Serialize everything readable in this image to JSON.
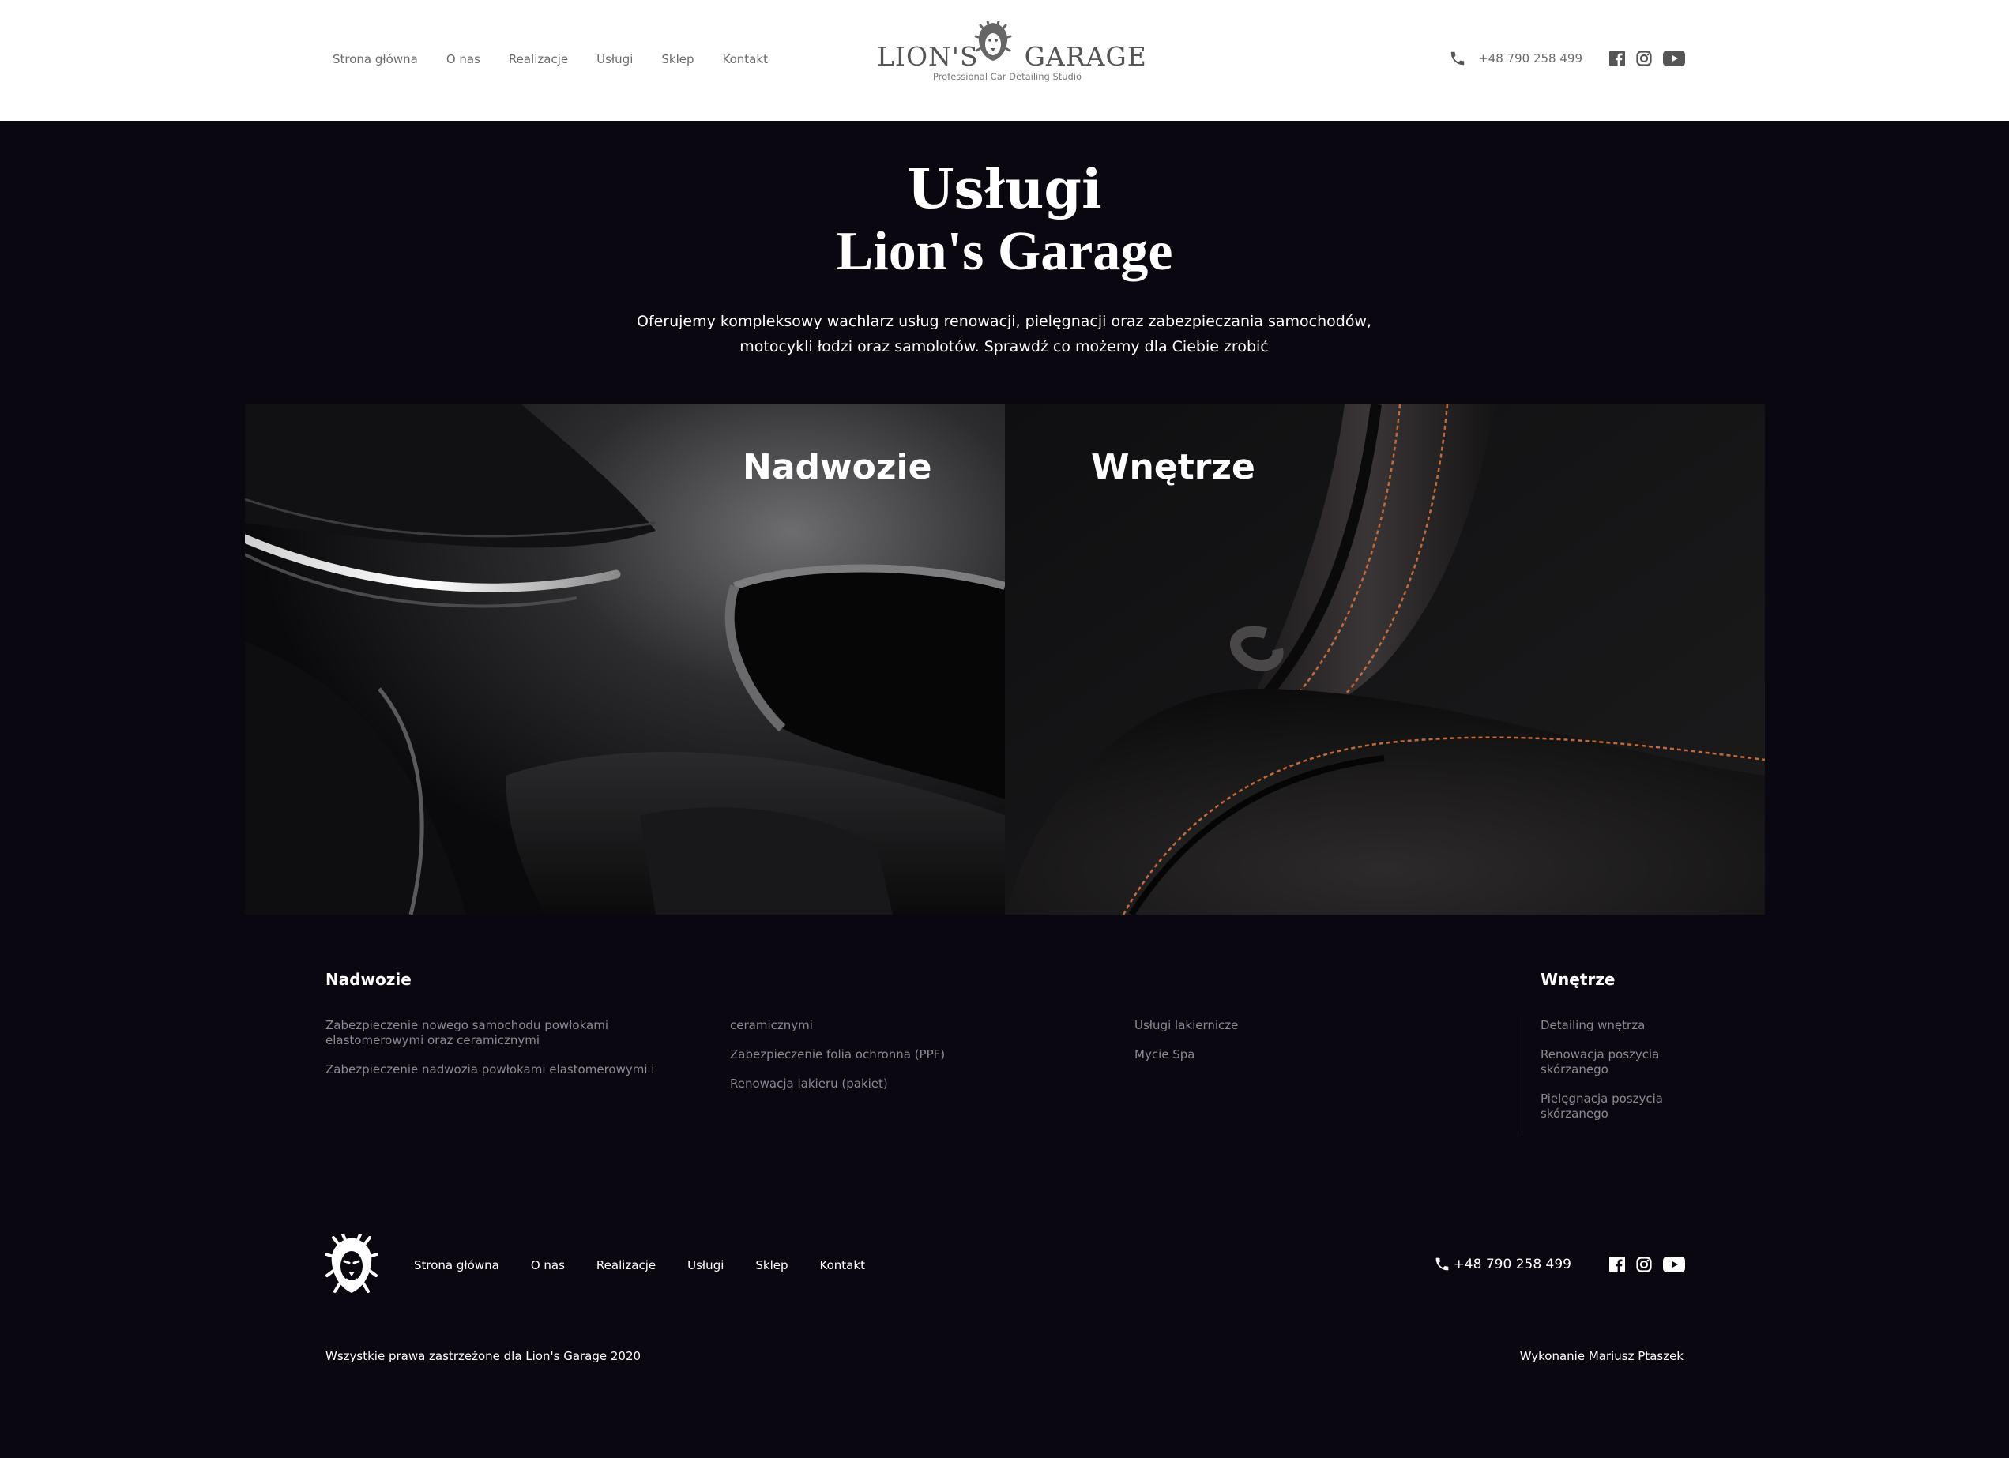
{
  "header": {
    "nav": [
      "Strona główna",
      "O nas",
      "Realizacje",
      "Usługi",
      "Sklep",
      "Kontakt"
    ],
    "logo": {
      "left": "LION'S",
      "right": "GARAGE",
      "tagline": "Professional Car Detailing Studio"
    },
    "phone": "+48 790 258 499",
    "phone_icon": "phone-icon",
    "social_icons": [
      "facebook-icon",
      "instagram-icon",
      "youtube-icon"
    ]
  },
  "hero": {
    "title": "Usługi",
    "subtitle": "Lion's Garage",
    "description_line1": "Oferujemy kompleksowy wachlarz usług renowacji, pielęgnacji oraz zabezpieczania samochodów,",
    "description_line2": "motocykli łodzi oraz samolotów. Sprawdź co możemy dla Ciebie zrobić"
  },
  "tiles": [
    {
      "label": "Nadwozie",
      "image": "car-headlight-photo"
    },
    {
      "label": "Wnętrze",
      "image": "leather-seat-photo"
    }
  ],
  "services": {
    "nadwozie": {
      "heading": "Nadwozie",
      "col1": [
        "Zabezpieczenie nowego samochodu powłokami elastomerowymi oraz ceramicznymi",
        "Zabezpieczenie nadwozia powłokami elastomerowymi i"
      ],
      "col2": [
        "ceramicznymi",
        "Zabezpieczenie folia ochronna (PPF)",
        "Renowacja lakieru (pakiet)"
      ],
      "col3": [
        "Usługi lakiernicze",
        "Mycie Spa"
      ]
    },
    "wnetrze": {
      "heading": "Wnętrze",
      "items": [
        "Detailing wnętrza",
        "Renowacja poszycia skórzanego",
        "Pielęgnacja poszycia skórzanego"
      ]
    }
  },
  "footer": {
    "nav": [
      "Strona główna",
      "O nas",
      "Realizacje",
      "Usługi",
      "Sklep",
      "Kontakt"
    ],
    "phone": "+48 790 258 499",
    "copyright": "Wszystkie prawa zastrzeżone dla Lion's Garage 2020",
    "credits": "Wykonanie Mariusz Ptaszek"
  },
  "colors": {
    "background": "#0b0711",
    "header_bg": "#ffffff",
    "nav_text": "#6b6b6b",
    "service_text": "#8d8894",
    "text_white": "#ffffff"
  }
}
